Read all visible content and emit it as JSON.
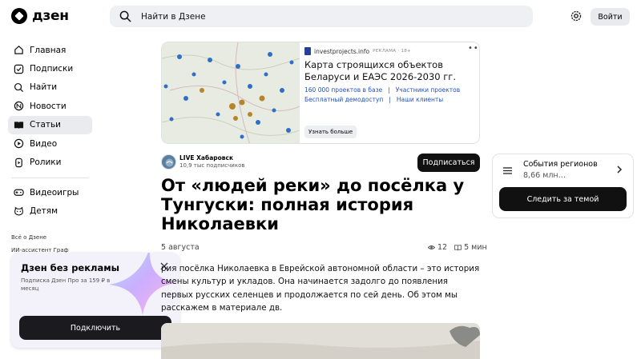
{
  "header": {
    "logo_text": "дзен",
    "search_placeholder": "Найти в Дзене",
    "login_label": "Войти"
  },
  "sidebar": {
    "items": [
      {
        "label": "Главная",
        "icon": "home-icon"
      },
      {
        "label": "Подписки",
        "icon": "subscriptions-icon"
      },
      {
        "label": "Найти",
        "icon": "search-icon"
      },
      {
        "label": "Новости",
        "icon": "news-icon"
      },
      {
        "label": "Статьи",
        "icon": "articles-icon",
        "active": true
      },
      {
        "label": "Видео",
        "icon": "video-icon"
      },
      {
        "label": "Ролики",
        "icon": "shorts-icon"
      }
    ],
    "items2": [
      {
        "label": "Видеоигры",
        "icon": "gamepad-icon"
      },
      {
        "label": "Детям",
        "icon": "kids-icon"
      }
    ],
    "footer_links": [
      "Всё о Дзене",
      "ИИ-ассистент Граф"
    ]
  },
  "promo": {
    "title": "Дзен без рекламы",
    "subtitle": "Подписка Дзен Про за 159 ₽ в месяц",
    "button": "Подключить"
  },
  "ad": {
    "source": "investprojects.info",
    "label": "РЕКЛАМА · 18+",
    "title": "Карта строящихся объектов Беларуси и ЕАЭС 2026-2030 гг.",
    "links": [
      "160 000 проектов в базе",
      "Участники проектов",
      "Бесплатный демодоступ",
      "Наши клиенты"
    ],
    "button": "Узнать больше"
  },
  "article": {
    "author": "LIVE Хабаровск",
    "subscribers": "10,9 тыс подписчиков",
    "subscribe_label": "Подписаться",
    "title": "От «людей реки» до посёлка у Тунгуски: полная история Николаевки",
    "date": "5 августа",
    "views": "12",
    "read_time": "5 мин",
    "body": "рия посёлка Николаевка в Еврейской автономной области – это история смены культур и укладов. Она начинается задолго до появления первых русских селенцев и продолжается по сей день. Об этом мы расскажем в материале дв."
  },
  "topic_card": {
    "title": "События регионов",
    "subtitle": "8,66 млн…",
    "button": "Следить за темой"
  },
  "colors": {
    "accent": "#111111",
    "link": "#2151c4",
    "sidebar_active": "#e9ebef"
  }
}
